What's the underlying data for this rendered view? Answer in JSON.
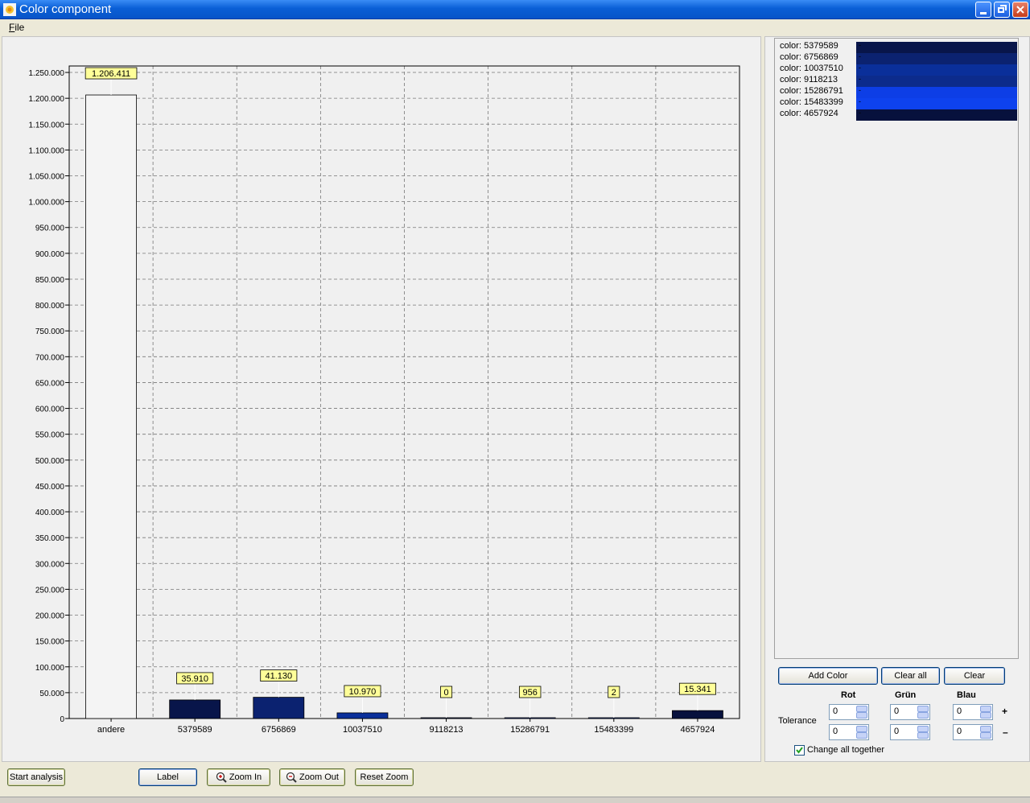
{
  "window": {
    "title": "Color component"
  },
  "menu": {
    "file_accel": "F",
    "file_rest": "ile"
  },
  "colors": {
    "titlebar": "#0a5fd6",
    "bar_andere": "#f4f4f4",
    "label_bg": "#ffff99"
  },
  "color_list": [
    {
      "label": "color: 5379589",
      "swatch": "#08154a",
      "mark": "-"
    },
    {
      "label": "color: 6756869",
      "swatch": "#0b2270",
      "mark": "-"
    },
    {
      "label": "color: 10037510",
      "swatch": "#0a2f9a",
      "mark": "-"
    },
    {
      "label": "color: 9118213",
      "swatch": "#0c2b8c",
      "mark": "-"
    },
    {
      "label": "color: 15286791",
      "swatch": "#0d3ee6",
      "mark": "-"
    },
    {
      "label": "color: 15483399",
      "swatch": "#0e42ee",
      "mark": "-"
    },
    {
      "label": "color: 4657924",
      "swatch": "#07113d",
      "mark": "-"
    }
  ],
  "buttons": {
    "add_color": "Add Color",
    "clear_all": "Clear all",
    "clear": "Clear",
    "start_analysis": "Start analysis",
    "label": "Label",
    "zoom_in": "Zoom In",
    "zoom_out": "Zoom Out",
    "reset_zoom": "Reset Zoom"
  },
  "tolerance": {
    "label": "Tolerance",
    "headers": [
      "Rot",
      "Grün",
      "Blau"
    ],
    "plus_values": [
      "0",
      "0",
      "0"
    ],
    "minus_values": [
      "0",
      "0",
      "0"
    ],
    "plus_sign": "+",
    "minus_sign": "–",
    "change_all_label": "Change all together",
    "change_all_checked": true
  },
  "chart_data": {
    "type": "bar",
    "categories": [
      "andere",
      "5379589",
      "6756869",
      "10037510",
      "9118213",
      "15286791",
      "15483399",
      "4657924"
    ],
    "values": [
      1206411,
      35910,
      41130,
      10970,
      0,
      956,
      2,
      15341
    ],
    "value_labels": [
      "1.206.411",
      "35.910",
      "41.130",
      "10.970",
      "0",
      "956",
      "2",
      "15.341"
    ],
    "bar_colors": [
      "#f4f4f4",
      "#08154a",
      "#0b2270",
      "#0a2f9a",
      "#0c2b8c",
      "#0d3ee6",
      "#0e42ee",
      "#07113d"
    ],
    "ylim": [
      0,
      1262500
    ],
    "yticks": [
      0,
      50000,
      100000,
      150000,
      200000,
      250000,
      300000,
      350000,
      400000,
      450000,
      500000,
      550000,
      600000,
      650000,
      700000,
      750000,
      800000,
      850000,
      900000,
      950000,
      1000000,
      1050000,
      1100000,
      1150000,
      1200000,
      1250000
    ],
    "ytick_labels": [
      "0",
      "50.000",
      "100.000",
      "150.000",
      "200.000",
      "250.000",
      "300.000",
      "350.000",
      "400.000",
      "450.000",
      "500.000",
      "550.000",
      "600.000",
      "650.000",
      "700.000",
      "750.000",
      "800.000",
      "850.000",
      "900.000",
      "950.000",
      "1.000.000",
      "1.050.000",
      "1.100.000",
      "1.150.000",
      "1.200.000",
      "1.250.000"
    ],
    "grid": true,
    "title": "",
    "xlabel": "",
    "ylabel": ""
  }
}
